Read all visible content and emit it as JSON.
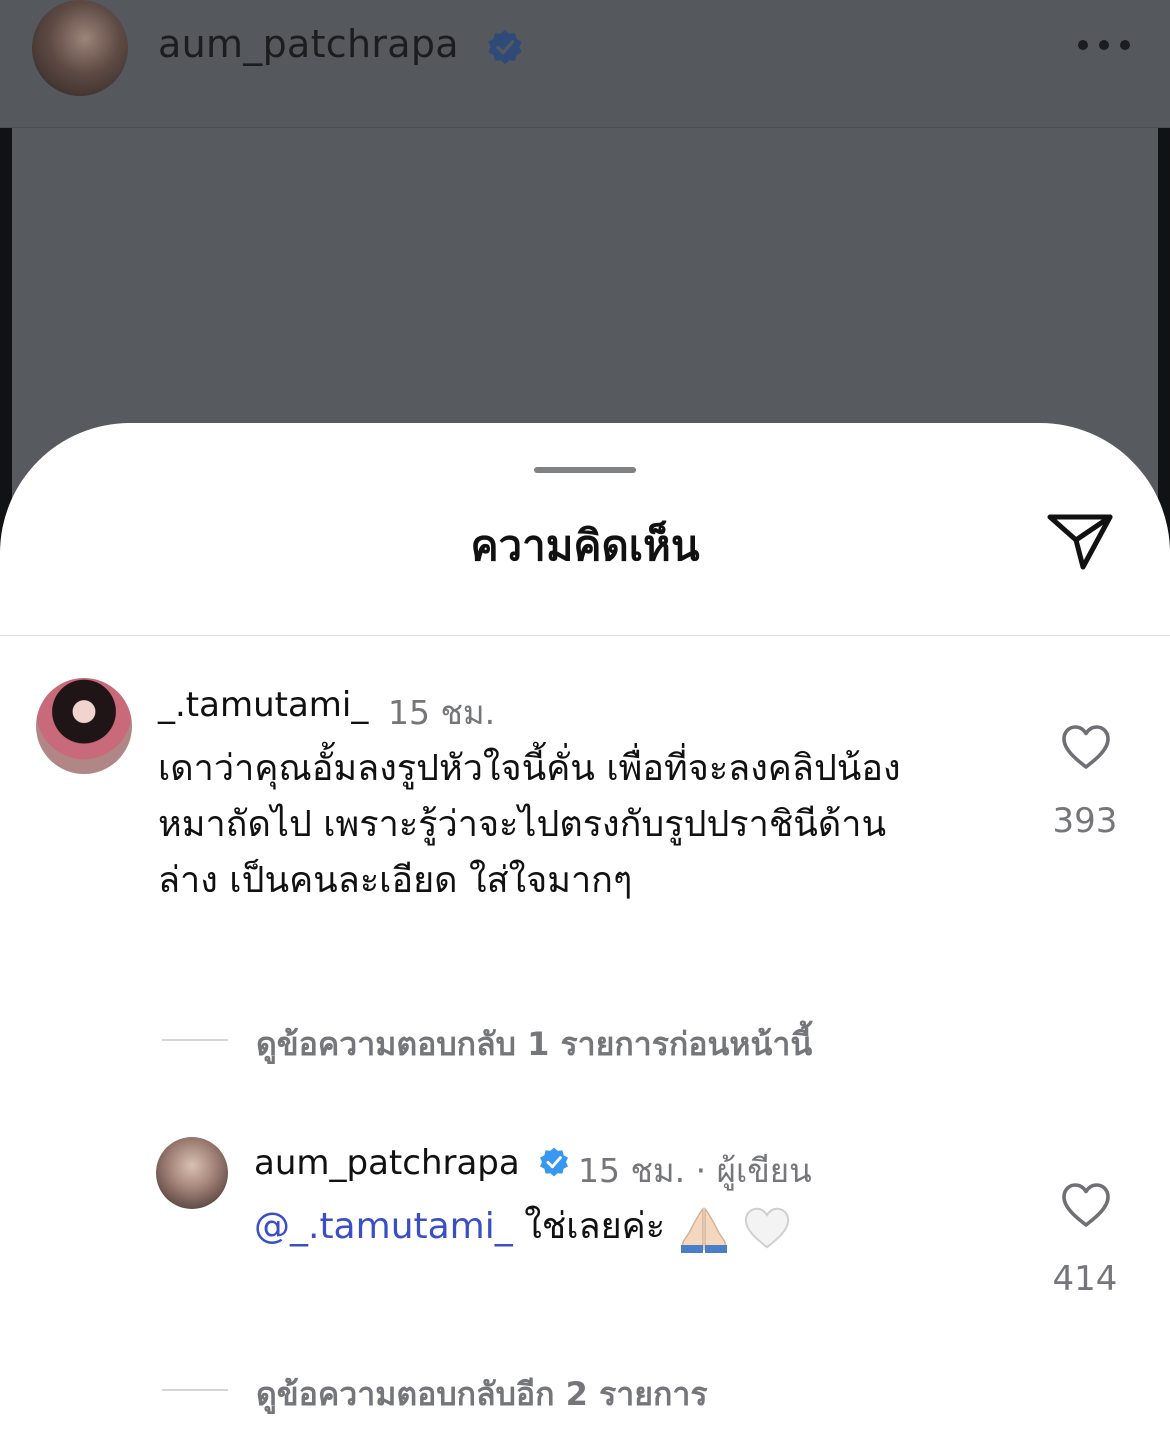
{
  "header": {
    "username": "aum_patchrapa",
    "verified": true,
    "more_icon": "more-horizontal-icon"
  },
  "sheet": {
    "title": "ความคิดเห็น",
    "share_icon": "send-icon"
  },
  "comments": [
    {
      "username": "_.tamutami_",
      "time": "15 ชม.",
      "lines": [
        "เดาว่าคุณอั้มลงรูปหัวใจนี้คั่น เพื่อที่จะลงคลิปน้อง",
        "หมาถัดไป เพราะรู้ว่าจะไปตรงกับรูปปราชินีด้าน",
        "ล่าง เป็นคนละเอียด ใส่ใจมากๆ"
      ],
      "likes": "393",
      "view_replies": "ดูข้อความตอบกลับ 1 รายการก่อนหน้านี้"
    },
    {
      "username": "aum_patchrapa",
      "verified": true,
      "time": "15 ชม.",
      "separator": "·",
      "role": "ผู้เขียน",
      "mention": "@_.tamutami_",
      "text": " ใช่เลยค่ะ",
      "emojis": [
        "folded-hands-emoji",
        "white-heart-emoji"
      ],
      "likes": "414",
      "view_more_replies": "ดูข้อความตอบกลับอีก 2 รายการ"
    }
  ],
  "colors": {
    "overlay": "#575a5e",
    "verified_blue": "#3897f0",
    "mention": "#3a4fc6",
    "muted_text": "#747679"
  }
}
